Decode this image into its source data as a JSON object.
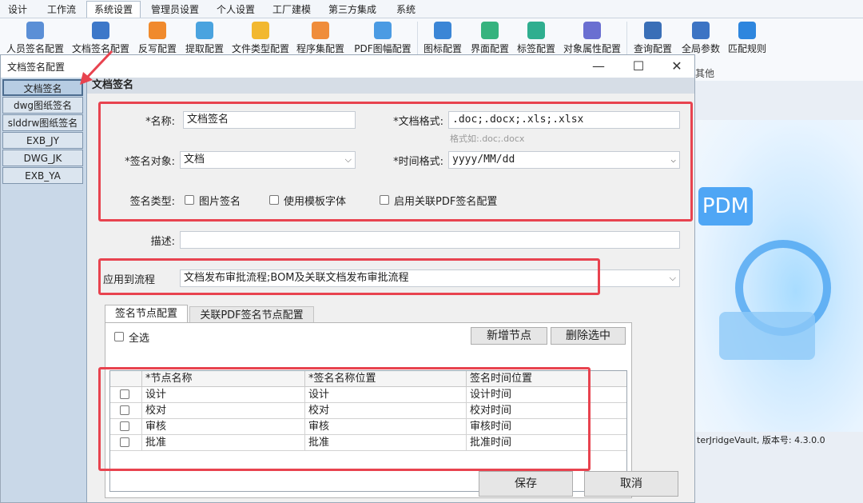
{
  "menu": {
    "tabs": [
      "设计",
      "工作流",
      "系统设置",
      "管理员设置",
      "个人设置",
      "工厂建模",
      "第三方集成",
      "系统"
    ],
    "active_index": 2
  },
  "ribbon": {
    "items": [
      "人员签名配置",
      "文档签名配置",
      "反写配置",
      "提取配置",
      "文件类型配置",
      "程序集配置",
      "PDF图幅配置",
      "图标配置",
      "界面配置",
      "标签配置",
      "对象属性配置",
      "查询配置",
      "全局参数",
      "匹配规则"
    ],
    "group_label": "其他"
  },
  "background": {
    "pdm_text": "PDM",
    "status_text": "terJridgeVault, 版本号: 4.3.0.0"
  },
  "dialog": {
    "title": "文档签名配置",
    "minimize": "—",
    "maximize": "☐",
    "close": "✕"
  },
  "left_list": {
    "items": [
      "文档签名",
      "dwg图纸签名",
      "slddrw图纸签名",
      "EXB_JY",
      "DWG_JK",
      "EXB_YA"
    ],
    "selected_index": 0
  },
  "form": {
    "header": "文档签名",
    "name_label": "*名称:",
    "name_value": "文档签名",
    "format_label": "*文档格式:",
    "format_value": ".doc;.docx;.xls;.xlsx",
    "format_hint": "格式如:.doc;.docx",
    "target_label": "*签名对象:",
    "target_value": "文档",
    "time_format_label": "*时间格式:",
    "time_format_value": "yyyy/MM/dd",
    "sign_type_label": "签名类型:",
    "opt_image": "图片签名",
    "opt_template_font": "使用模板字体",
    "opt_pdf": "启用关联PDF签名配置",
    "desc_label": "描述:",
    "desc_value": "",
    "apply_label": "应用到流程",
    "apply_value": "文档发布审批流程;BOM及关联文档发布审批流程"
  },
  "node_tabs": [
    "签名节点配置",
    "关联PDF签名节点配置"
  ],
  "node_section": {
    "select_all": "全选",
    "add_button": "新增节点",
    "delete_button": "删除选中",
    "columns": [
      "*节点名称",
      "*签名名称位置",
      "签名时间位置"
    ],
    "rows": [
      [
        "设计",
        "设计",
        "设计时间"
      ],
      [
        "校对",
        "校对",
        "校对时间"
      ],
      [
        "审核",
        "审核",
        "审核时间"
      ],
      [
        "批准",
        "批准",
        "批准时间"
      ]
    ]
  },
  "footer": {
    "save": "保存",
    "cancel": "取消"
  },
  "colors": {
    "highlight_red": "#e8434f",
    "ribbon_bg": "#f7f9fc",
    "list_bg": "#c9d8e8"
  }
}
